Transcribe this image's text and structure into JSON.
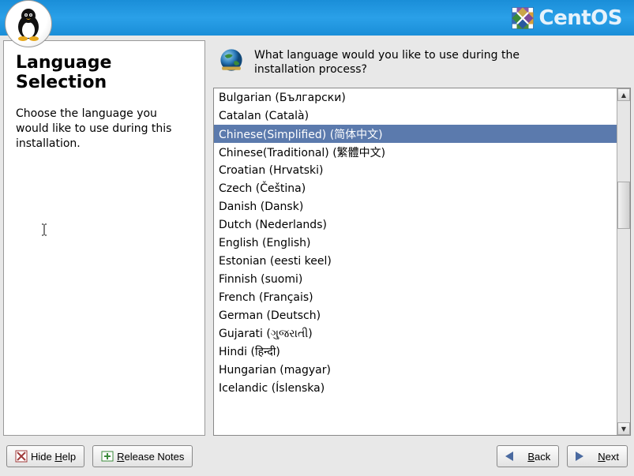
{
  "brand": {
    "name": "CentOS"
  },
  "left": {
    "title": "Language Selection",
    "body": "Choose the language you would like to use during this installation."
  },
  "prompt": "What language would you like to use during the installation process?",
  "languages": [
    "Bulgarian (Български)",
    "Catalan (Català)",
    "Chinese(Simplified) (简体中文)",
    "Chinese(Traditional) (繁體中文)",
    "Croatian (Hrvatski)",
    "Czech (Čeština)",
    "Danish (Dansk)",
    "Dutch (Nederlands)",
    "English (English)",
    "Estonian (eesti keel)",
    "Finnish (suomi)",
    "French (Français)",
    "German (Deutsch)",
    "Gujarati (ગુજરાતી)",
    "Hindi (हिन्दी)",
    "Hungarian (magyar)",
    "Icelandic (Íslenska)"
  ],
  "selected_index": 2,
  "buttons": {
    "hide_help": {
      "pre": "Hide ",
      "u": "H",
      "post": "elp"
    },
    "release_notes": {
      "pre": "",
      "u": "R",
      "post": "elease Notes"
    },
    "back": {
      "pre": "",
      "u": "B",
      "post": "ack"
    },
    "next": {
      "pre": "",
      "u": "N",
      "post": "ext"
    }
  }
}
